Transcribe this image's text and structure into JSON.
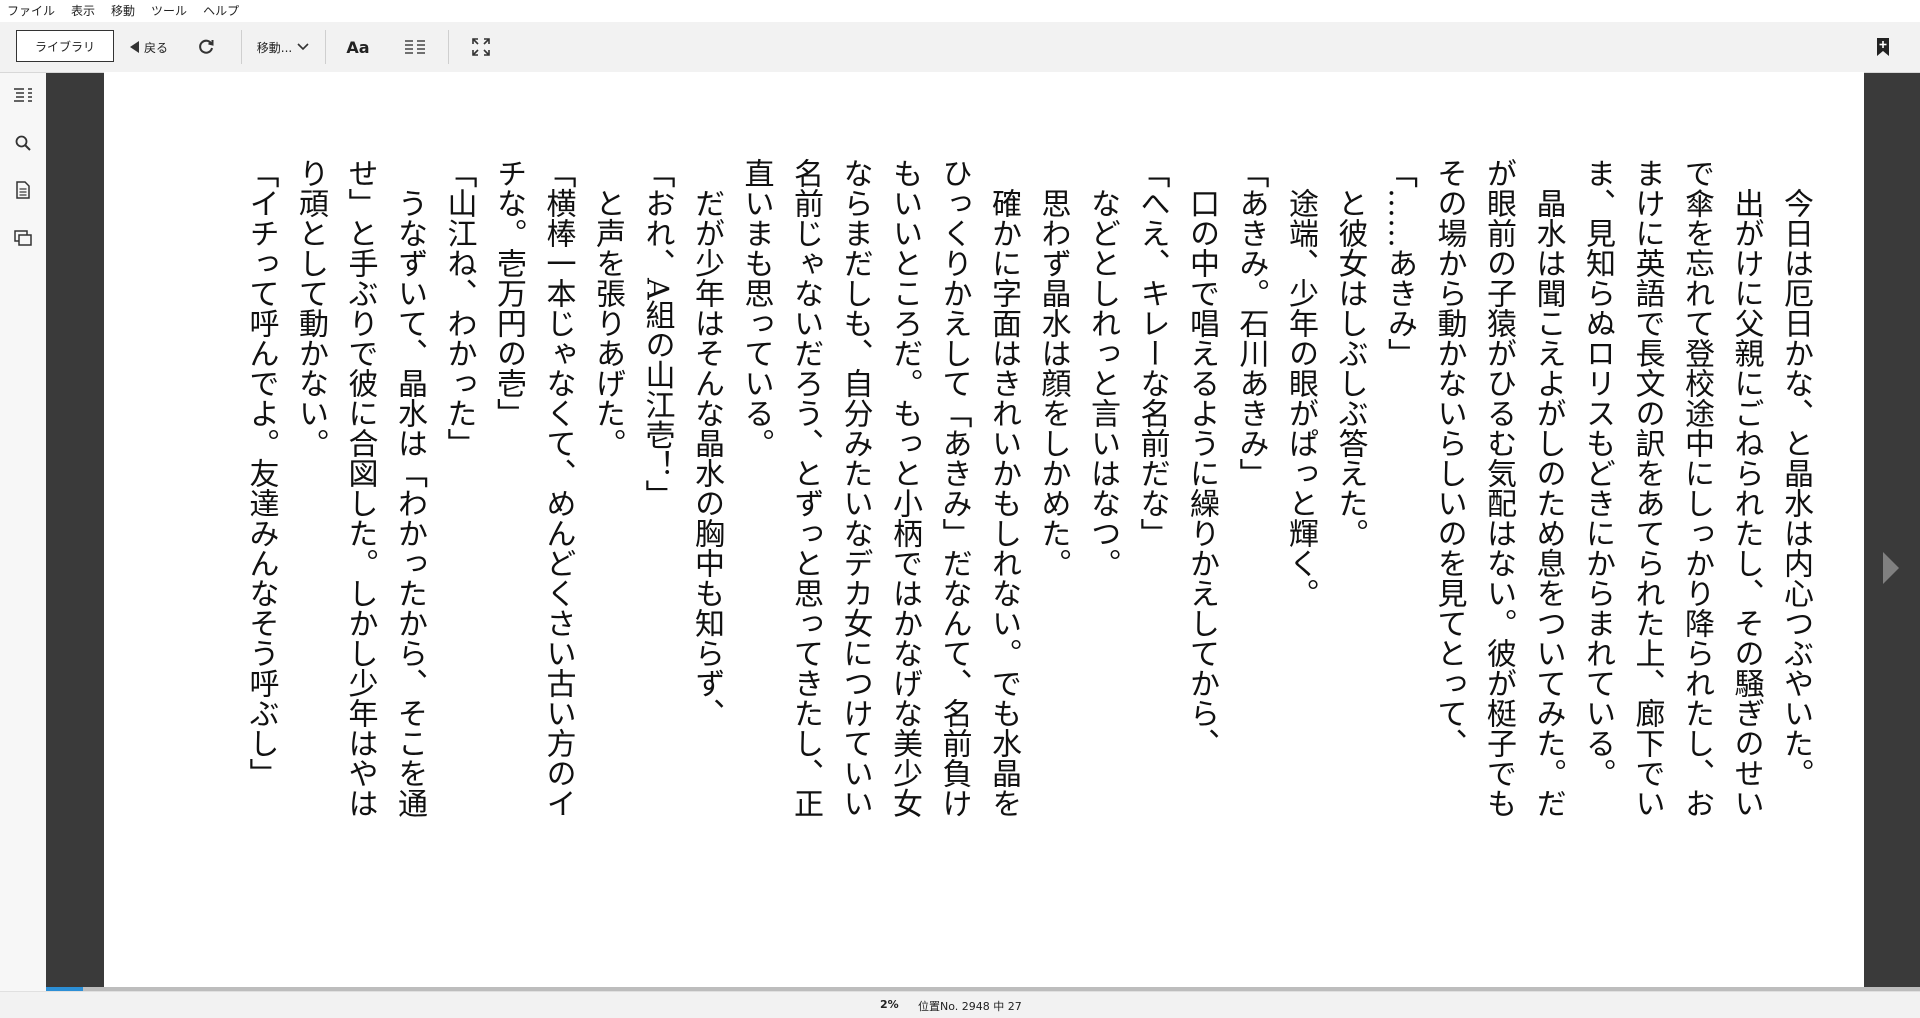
{
  "menubar": {
    "items": [
      "ファイル",
      "表示",
      "移動",
      "ツール",
      "ヘルプ"
    ]
  },
  "toolbar": {
    "library_label": "ライブラリ",
    "back_label": "戻る",
    "goto_label": "移動...",
    "font_label": "Aa"
  },
  "reader": {
    "paragraphs": [
      {
        "indent": true,
        "text": "今日は厄日かな、と晶水は内心つぶやいた。"
      },
      {
        "indent": true,
        "text": "出がけに父親にごねられたし、その騒ぎのせいで傘を忘れて登校途中にしっかり降られたし、おまけに英語で長文の訳をあてられた上、廊下でいま、見知らぬロリスもどきにからまれている。"
      },
      {
        "indent": true,
        "text": "晶水は聞こえよがしのため息をついてみた。だが眼前の子猿がひるむ気配はない。彼が梃子でもその場から動かないらしいのを見てとって、"
      },
      {
        "indent": false,
        "text": "「……あきみ」"
      },
      {
        "indent": true,
        "text": "と彼女はしぶしぶ答えた。"
      },
      {
        "indent": true,
        "text": "途端、少年の眼がぱっと輝く。"
      },
      {
        "indent": false,
        "text": "「あきみ。石川あきみ」"
      },
      {
        "indent": true,
        "text": "口の中で唱えるように繰りかえしてから、"
      },
      {
        "indent": false,
        "text": "「へえ、キレーな名前だな」"
      },
      {
        "indent": true,
        "text": "などとしれっと言いはなつ。"
      },
      {
        "indent": true,
        "text": "思わず晶水は顔をしかめた。"
      },
      {
        "indent": true,
        "text": "確かに字面はきれいかもしれない。でも水晶をひっくりかえして「あきみ」だなんて、名前負けもいいところだ。もっと小柄ではかなげな美少女ならまだしも、自分みたいなデカ女につけていい名前じゃないだろう、とずっと思ってきたし、正直いまも思っている。"
      },
      {
        "indent": true,
        "text": "だが少年はそんな晶水の胸中も知らず、"
      },
      {
        "indent": false,
        "text": "「おれ、A組の山江壱！」"
      },
      {
        "indent": true,
        "text": "と声を張りあげた。"
      },
      {
        "indent": false,
        "text": "「横棒一本じゃなくて、めんどくさい古い方のイチな。壱万円の壱」"
      },
      {
        "indent": false,
        "text": "「山江ね、わかった」"
      },
      {
        "indent": true,
        "text": "うなずいて、晶水は「わかったから、そこを通せ」と手ぶりで彼に合図した。しかし少年はやはり頑として動かない。"
      },
      {
        "indent": false,
        "text": "「イチって呼んでよ。友達みんなそう呼ぶし」"
      }
    ]
  },
  "status": {
    "percent_label": "2%",
    "location_label": "位置No. 2948 中 27",
    "progress_fraction": 0.02
  },
  "colors": {
    "accent": "#2c8fd6",
    "reader_background": "#3a3a3a"
  }
}
